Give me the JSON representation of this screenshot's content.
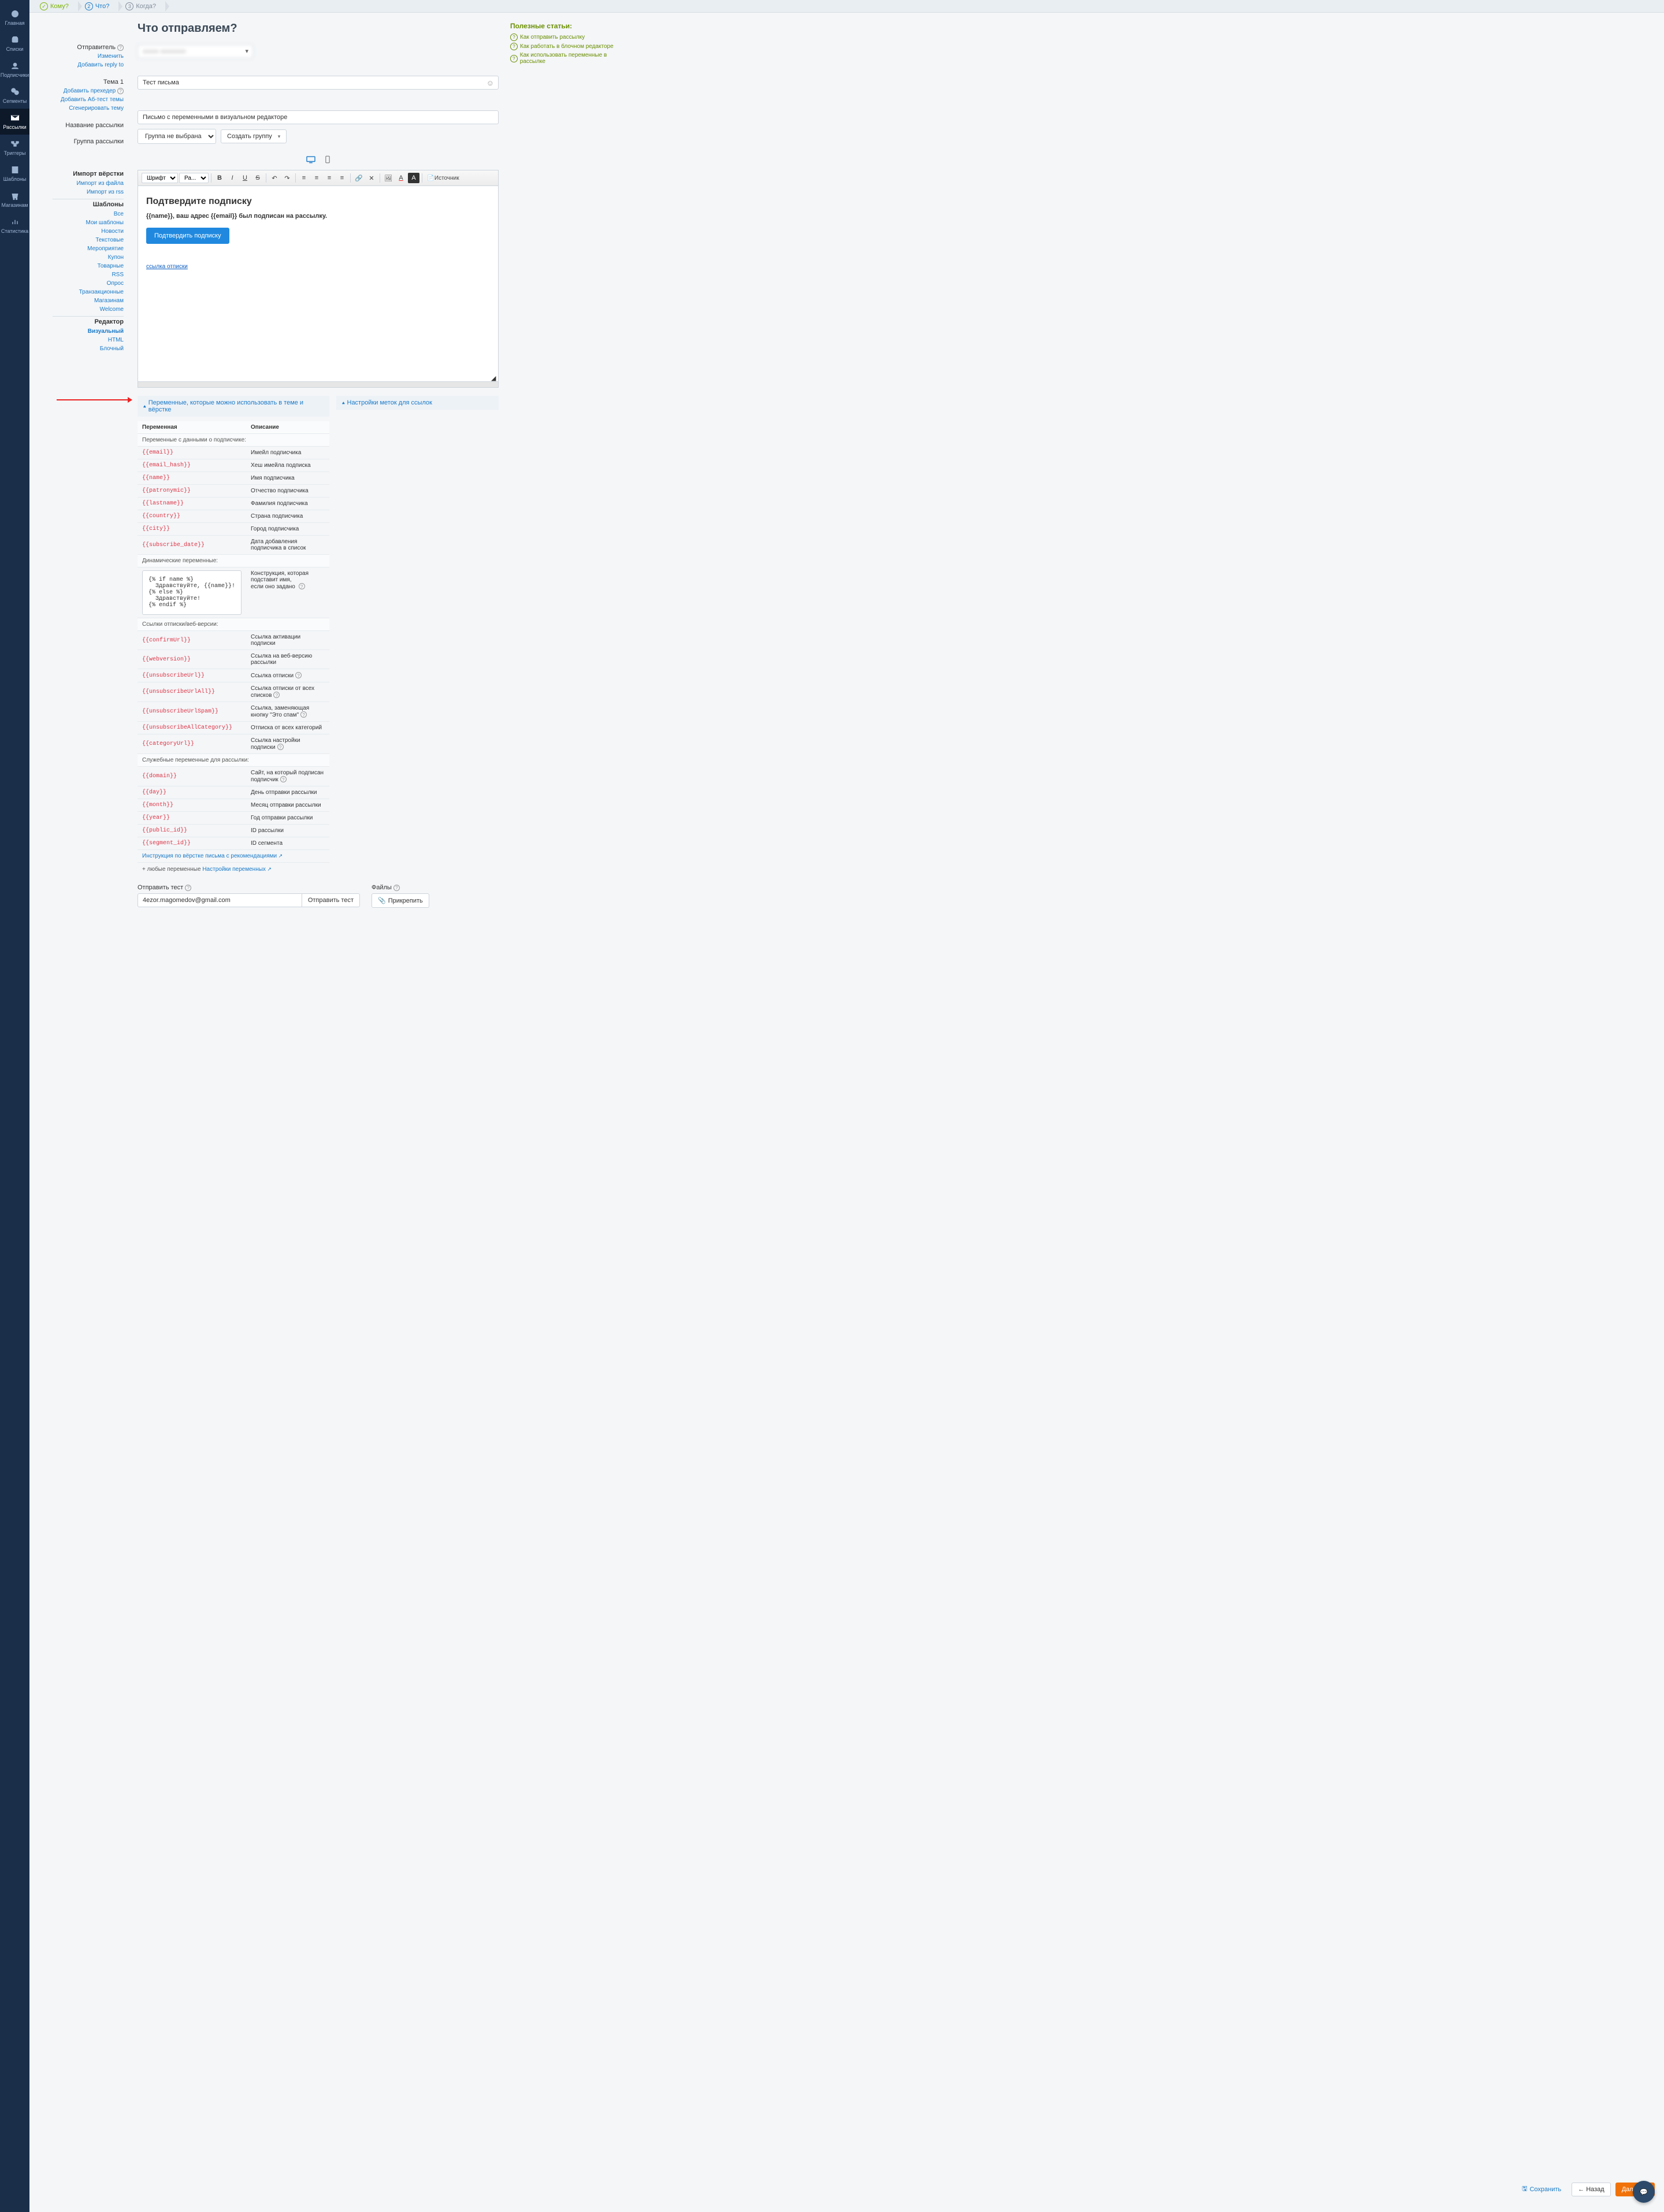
{
  "nav": {
    "items": [
      {
        "label": "Главная"
      },
      {
        "label": "Списки"
      },
      {
        "label": "Подписчики"
      },
      {
        "label": "Сегменты"
      },
      {
        "label": "Рассылки"
      },
      {
        "label": "Триггеры"
      },
      {
        "label": "Шаблоны"
      },
      {
        "label": "Магазинам"
      },
      {
        "label": "Статистика"
      }
    ]
  },
  "steps": {
    "s1": "Кому?",
    "s2": "Что?",
    "s3": "Когда?"
  },
  "title": "Что отправляем?",
  "sender": {
    "label": "Отправитель",
    "edit": "Изменить",
    "add_reply": "Добавить reply to"
  },
  "subject": {
    "label": "Тема 1",
    "value": "Тест письма",
    "add_preheader": "Добавить прехедер",
    "add_ab": "Добавить Аб-тест темы",
    "generate": "Сгенерировать тему"
  },
  "name": {
    "label": "Название рассылки",
    "value": "Письмо с переменными в визуальном редакторе"
  },
  "group": {
    "label": "Группа рассылки",
    "select": "Группа не выбрана",
    "create": "Создать группу"
  },
  "side": {
    "import_h": "Импорт вёрстки",
    "import_file": "Импорт из файла",
    "import_rss": "Импорт из rss",
    "tpl_h": "Шаблоны",
    "tpl": [
      "Все",
      "Мои шаблоны",
      "Новости",
      "Текстовые",
      "Мероприятие",
      "Купон",
      "Товарные",
      "RSS",
      "Опрос",
      "Транзакционные",
      "Магазинам",
      "Welcome"
    ],
    "ed_h": "Редактор",
    "ed": [
      "Визуальный",
      "HTML",
      "Блочный"
    ]
  },
  "toolbar": {
    "font": "Шрифт",
    "size": "Ра...",
    "src": "Источник"
  },
  "editor": {
    "heading": "Подтвердите подписку",
    "line": "{{name}}, ваш адрес {{email}} был подписан на рассылку.",
    "btn": "Подтвердить подписку",
    "unsub": "ссылка отписки"
  },
  "articles": {
    "h": "Полезные статьи:",
    "a1": "Как отправить рассылку",
    "a2": "Как работать в блочном редакторе",
    "a3": "Как использовать переменные в рассылке"
  },
  "acc": {
    "vars": "Переменные, которые можно использовать в теме и вёрстке",
    "labels": "Настройки меток для ссылок"
  },
  "vars": {
    "col_var": "Переменная",
    "col_desc": "Описание",
    "sect1": "Переменные с данными о подписчике:",
    "rows1": [
      {
        "v": "{{email}}",
        "d": "Имейл подписчика"
      },
      {
        "v": "{{email_hash}}",
        "d": "Хеш имейла подписка"
      },
      {
        "v": "{{name}}",
        "d": "Имя подписчика"
      },
      {
        "v": "{{patronymic}}",
        "d": "Отчество подписчика"
      },
      {
        "v": "{{lastname}}",
        "d": "Фамилия подписчика"
      },
      {
        "v": "{{country}}",
        "d": "Страна подписчика"
      },
      {
        "v": "{{city}}",
        "d": "Город подписчика"
      },
      {
        "v": "{{subscribe_date}}",
        "d": "Дата добавления подписчика в список"
      }
    ],
    "sect2": "Динамические переменные:",
    "code": "{% if name %}\n  Здравствуйте, {{name}}!\n{% else %}\n  Здравствуйте!\n{% endif %}",
    "code_desc1": "Конструкция, которая подставит имя,",
    "code_desc2": "если оно задано",
    "sect3": "Ссылки отписки/веб-версии:",
    "rows3": [
      {
        "v": "{{confirmUrl}}",
        "d": "Ссылка активации подписки"
      },
      {
        "v": "{{webversion}}",
        "d": "Ссылка на веб-версию рассылки"
      },
      {
        "v": "{{unsubscribeUrl}}",
        "d": "Ссылка отписки",
        "q": true
      },
      {
        "v": "{{unsubscribeUrlAll}}",
        "d": "Ссылка отписки от всех списков",
        "q": true
      },
      {
        "v": "{{unsubscribeUrlSpam}}",
        "d": "Ссылка, заменяющая кнопку \"Это спам\"",
        "q": true
      },
      {
        "v": "{{unsubscribeAllCategory}}",
        "d": "Отписка от всех категорий"
      },
      {
        "v": "{{categoryUrl}}",
        "d": "Ссылка настройки подписки",
        "q": true
      }
    ],
    "sect4": "Служебные переменные для рассылки:",
    "rows4": [
      {
        "v": "{{domain}}",
        "d": "Сайт, на который подписан подписчик",
        "q": true
      },
      {
        "v": "{{day}}",
        "d": "День отправки рассылки"
      },
      {
        "v": "{{month}}",
        "d": "Месяц отправки рассылки"
      },
      {
        "v": "{{year}}",
        "d": "Год отправки рассылки"
      },
      {
        "v": "{{public_id}}",
        "d": "ID рассылки"
      },
      {
        "v": "{{segment_id}}",
        "d": "ID сегмента"
      }
    ],
    "reco_link": "Инструкция по вёрстке письма с рекомендациями",
    "any_vars": "+ любые переменные ",
    "any_vars_link": "Настройки переменных"
  },
  "test": {
    "label": "Отправить тест",
    "value": "4ezor.magomedov@gmail.com",
    "btn": "Отправить тест"
  },
  "files": {
    "label": "Файлы",
    "btn": "Прикрепить"
  },
  "footer": {
    "save": "Сохранить",
    "back": "← Назад",
    "next": "Далее →"
  }
}
